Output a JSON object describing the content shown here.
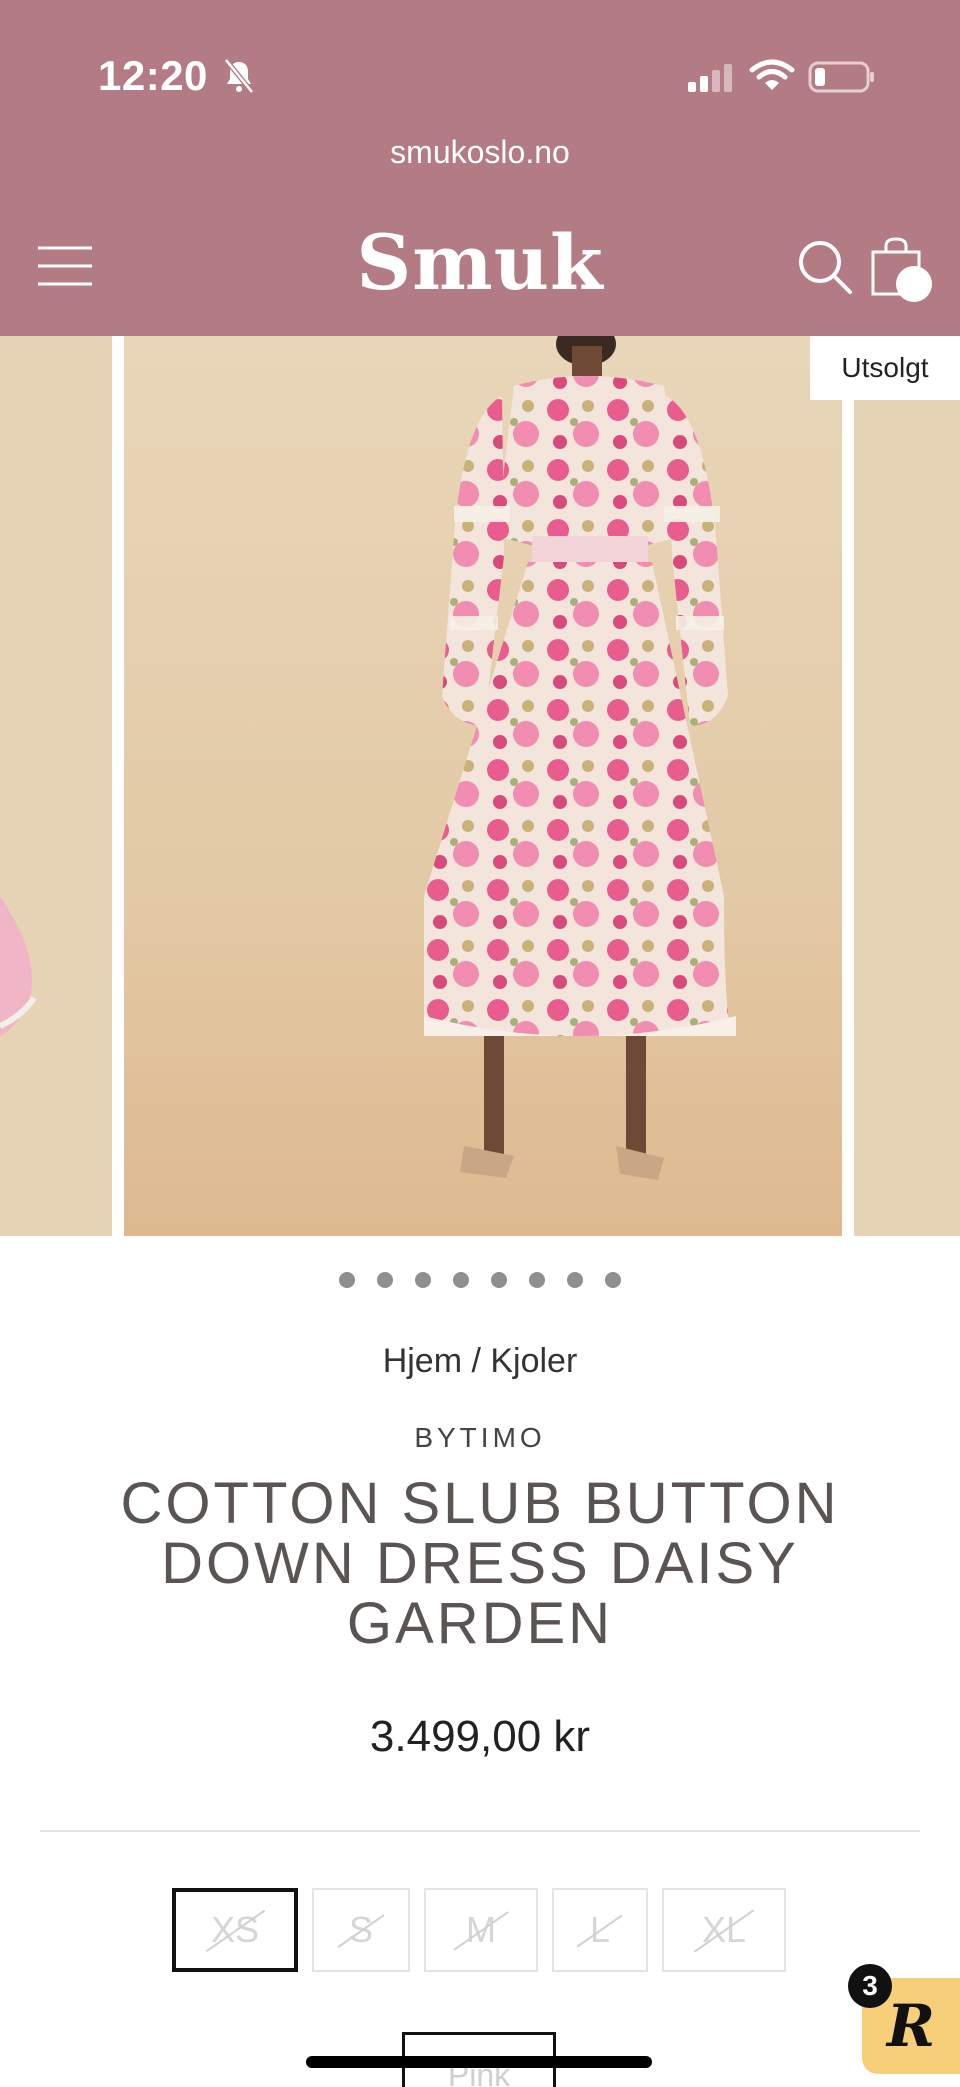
{
  "status_bar": {
    "time": "12:20"
  },
  "browser": {
    "url": "smukoslo.no"
  },
  "header": {
    "logo": "Smuk"
  },
  "gallery": {
    "badge": "Utsolgt",
    "slide_count": 8
  },
  "breadcrumb": "Hjem / Kjoler",
  "product": {
    "brand": "BYTIMO",
    "title": "COTTON SLUB BUTTON DOWN DRESS DAISY GARDEN",
    "price": "3.499,00 kr"
  },
  "sizes": [
    "XS",
    "S",
    "M",
    "L",
    "XL"
  ],
  "selected_size": "XS",
  "color": "Pink",
  "reviews_widget": {
    "letter": "R",
    "count": "3"
  },
  "colors": {
    "header_bg": "#b37b84",
    "backdrop": "#e3caa6",
    "widget_bg": "#f7cf78"
  }
}
